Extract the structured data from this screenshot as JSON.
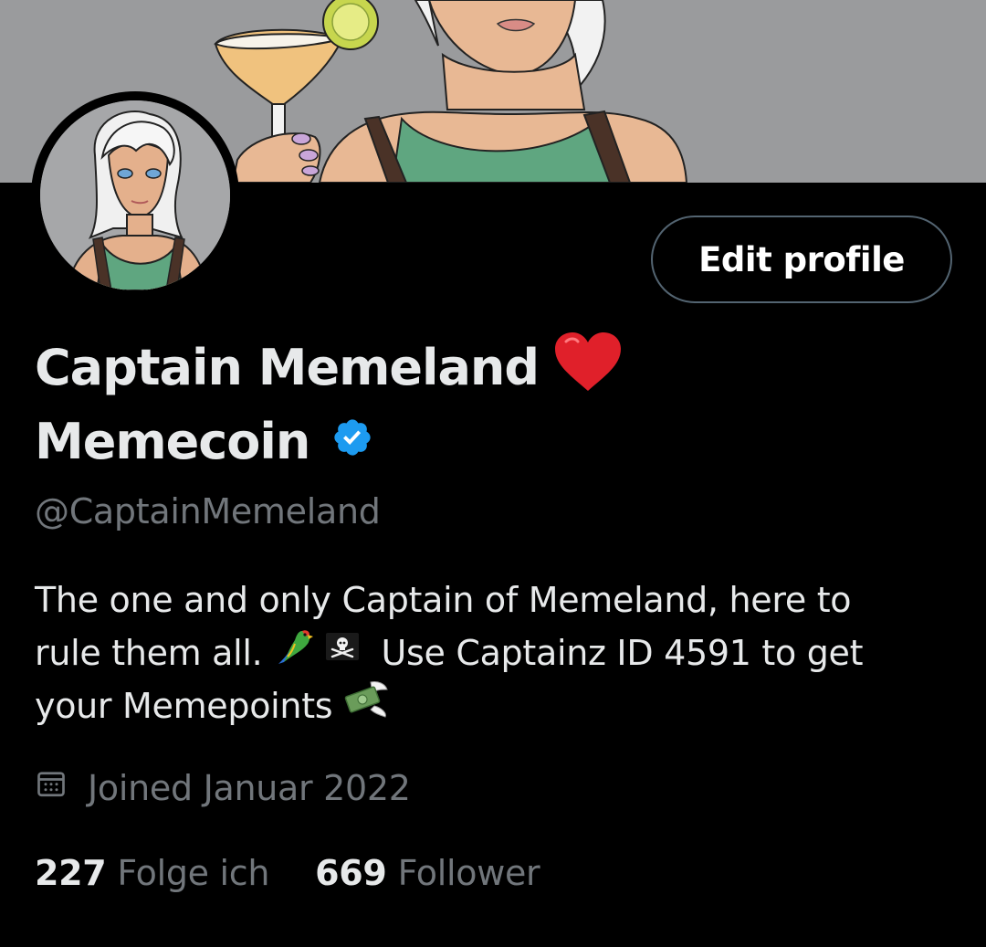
{
  "profile": {
    "name_line1": "Captain Memeland",
    "name_line2": "Memecoin",
    "handle": "@CaptainMemeland",
    "edit_button": "Edit profile",
    "bio_line1": "The one and only Captain of Memeland, here to",
    "bio_line2_a": "rule them all.",
    "bio_line2_b": "Use Captainz ID 4591 to get",
    "bio_line3": "your Memepoints",
    "joined": "Joined Januar 2022",
    "following_count": "227",
    "following_label": "Folge ich",
    "followers_count": "669",
    "followers_label": "Follower"
  },
  "icons": {
    "name_emoji": "red-heart-icon",
    "verified": "verified-badge-icon",
    "bio_emojis": [
      "parrot-icon",
      "pirate-flag-icon",
      "money-with-wings-icon"
    ],
    "joined": "calendar-icon"
  },
  "colors": {
    "background": "#000000",
    "text_primary": "#e7e9ea",
    "text_secondary": "#71767b",
    "verified_blue": "#1d9bf0",
    "heart_red": "#e0202a",
    "button_border": "#536471",
    "banner_gray": "#9a9b9d"
  }
}
